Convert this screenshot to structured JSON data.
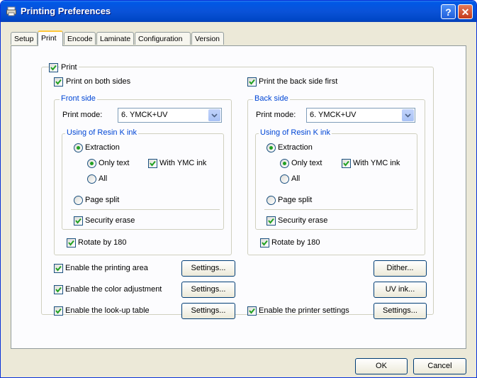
{
  "window": {
    "title": "Printing Preferences"
  },
  "tabs": [
    "Setup",
    "Print",
    "Encode",
    "Laminate",
    "Configuration",
    "Version"
  ],
  "print": {
    "label": "Print",
    "both_sides_label": "Print on both sides",
    "back_first_label": "Print the back side first",
    "front": {
      "title": "Front side",
      "mode_label": "Print mode:",
      "mode_value": "6. YMCK+UV",
      "resin_title": "Using of Resin K ink",
      "extraction": "Extraction",
      "only_text": "Only text",
      "with_ymc": "With YMC ink",
      "all": "All",
      "page_split": "Page split",
      "security_erase": "Security erase",
      "rotate": "Rotate by 180"
    },
    "back": {
      "title": "Back side",
      "mode_label": "Print mode:",
      "mode_value": "6. YMCK+UV",
      "resin_title": "Using of Resin K ink",
      "extraction": "Extraction",
      "only_text": "Only text",
      "with_ymc": "With YMC ink",
      "all": "All",
      "page_split": "Page split",
      "security_erase": "Security erase",
      "rotate": "Rotate by 180"
    },
    "printing_area_label": "Enable the printing area",
    "color_adjust_label": "Enable the color adjustment",
    "lookup_label": "Enable the look-up table",
    "printer_settings_label": "Enable the printer settings",
    "settings_label": "Settings...",
    "dither_label": "Dither...",
    "uv_ink_label": "UV ink..."
  },
  "footer": {
    "ok_label": "OK",
    "cancel_label": "Cancel"
  }
}
